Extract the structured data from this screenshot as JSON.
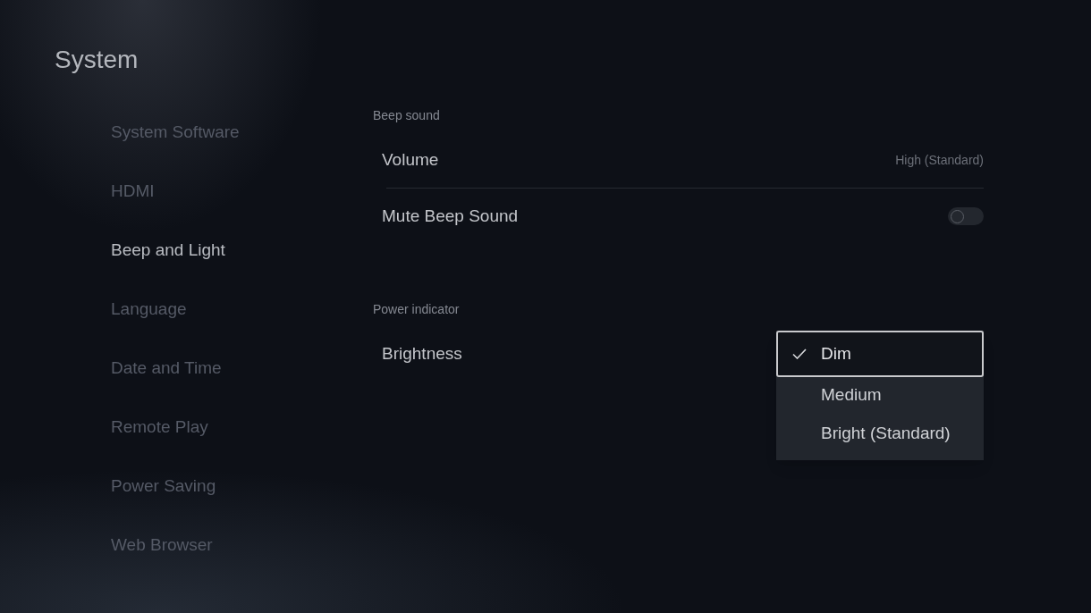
{
  "page": {
    "title": "System"
  },
  "sidebar": {
    "items": [
      {
        "label": "System Software",
        "selected": false
      },
      {
        "label": "HDMI",
        "selected": false
      },
      {
        "label": "Beep and Light",
        "selected": true
      },
      {
        "label": "Language",
        "selected": false
      },
      {
        "label": "Date and Time",
        "selected": false
      },
      {
        "label": "Remote Play",
        "selected": false
      },
      {
        "label": "Power Saving",
        "selected": false
      },
      {
        "label": "Web Browser",
        "selected": false
      }
    ]
  },
  "sections": [
    {
      "heading": "Beep sound",
      "rows": [
        {
          "kind": "value",
          "label": "Volume",
          "value": "High (Standard)"
        },
        {
          "kind": "toggle",
          "label": "Mute Beep Sound",
          "on": false
        }
      ]
    },
    {
      "heading": "Power indicator",
      "rows": [
        {
          "kind": "dropdown",
          "label": "Brightness",
          "options": [
            {
              "label": "Dim",
              "selected": true
            },
            {
              "label": "Medium",
              "selected": false
            },
            {
              "label": "Bright (Standard)",
              "selected": false
            }
          ]
        }
      ]
    }
  ]
}
